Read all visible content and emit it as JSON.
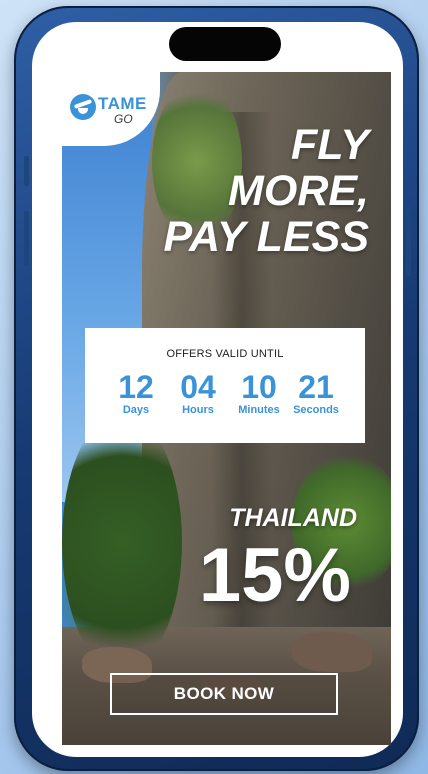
{
  "brand": {
    "name": "TAME",
    "subname": "GO",
    "color": "#3a93d8",
    "icon": "boat-logo-icon"
  },
  "headline": {
    "lines": [
      "FLY",
      "MORE,",
      "PAY LESS"
    ]
  },
  "offer": {
    "label": "OFFERS VALID UNTIL",
    "countdown": [
      {
        "value": "12",
        "unit": "Days"
      },
      {
        "value": "04",
        "unit": "Hours"
      },
      {
        "value": "10",
        "unit": "Minutes"
      },
      {
        "value": "21",
        "unit": "Seconds"
      }
    ]
  },
  "promo": {
    "destination": "THAILAND",
    "discount": "15%"
  },
  "cta": {
    "label": "BOOK NOW"
  }
}
